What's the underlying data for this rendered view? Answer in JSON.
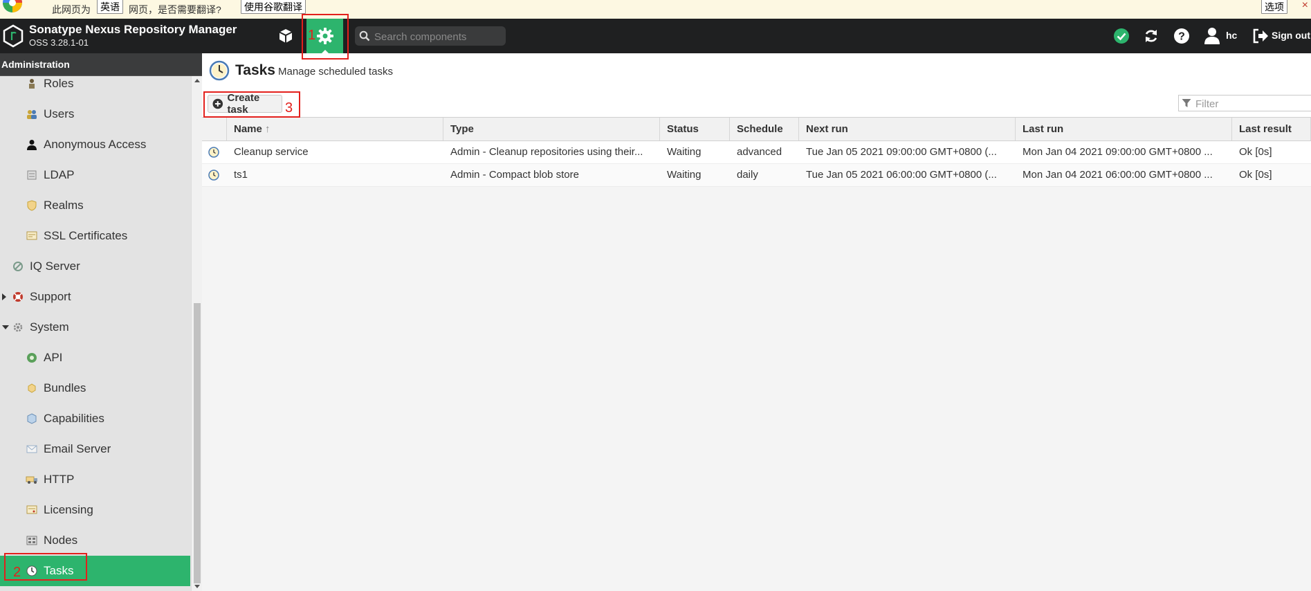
{
  "translate_bar": {
    "text_prefix": "此网页为",
    "language_button": "英语",
    "text_suffix": "网页，是否需要翻译?",
    "translate_button": "使用谷歌翻译",
    "options_button": "选项",
    "close": "×"
  },
  "header": {
    "app_title": "Sonatype Nexus Repository Manager",
    "app_version": "OSS 3.28.1-01",
    "search_placeholder": "Search components",
    "user": "hc",
    "sign_out": "Sign out",
    "accent": "#2db46d"
  },
  "sidebar": {
    "title": "Administration",
    "items": [
      {
        "label": "Roles",
        "icon": "roles-icon",
        "level": 2
      },
      {
        "label": "Users",
        "icon": "users-icon",
        "level": 2
      },
      {
        "label": "Anonymous Access",
        "icon": "anonymous-icon",
        "level": 2
      },
      {
        "label": "LDAP",
        "icon": "ldap-icon",
        "level": 2
      },
      {
        "label": "Realms",
        "icon": "realms-icon",
        "level": 2
      },
      {
        "label": "SSL Certificates",
        "icon": "ssl-icon",
        "level": 2
      },
      {
        "label": "IQ Server",
        "icon": "iq-server-icon",
        "level": 1
      },
      {
        "label": "Support",
        "icon": "support-icon",
        "level": 1,
        "expander": "collapsed"
      },
      {
        "label": "System",
        "icon": "system-icon",
        "level": 1,
        "expander": "expanded"
      },
      {
        "label": "API",
        "icon": "api-icon",
        "level": 2
      },
      {
        "label": "Bundles",
        "icon": "bundles-icon",
        "level": 2
      },
      {
        "label": "Capabilities",
        "icon": "capabilities-icon",
        "level": 2
      },
      {
        "label": "Email Server",
        "icon": "email-icon",
        "level": 2
      },
      {
        "label": "HTTP",
        "icon": "http-icon",
        "level": 2
      },
      {
        "label": "Licensing",
        "icon": "licensing-icon",
        "level": 2
      },
      {
        "label": "Nodes",
        "icon": "nodes-icon",
        "level": 2
      },
      {
        "label": "Tasks",
        "icon": "tasks-icon",
        "level": 2,
        "selected": true
      }
    ]
  },
  "main": {
    "title": "Tasks",
    "subtitle": "Manage scheduled tasks",
    "create_button": "Create task",
    "filter_placeholder": "Filter",
    "columns": [
      "Name",
      "Type",
      "Status",
      "Schedule",
      "Next run",
      "Last run",
      "Last result"
    ],
    "sort_indicator": "↑",
    "rows": [
      {
        "name": "Cleanup service",
        "type": "Admin - Cleanup repositories using their...",
        "status": "Waiting",
        "schedule": "advanced",
        "next_run": "Tue Jan 05 2021 09:00:00 GMT+0800 (...",
        "last_run": "Mon Jan 04 2021 09:00:00 GMT+0800 ...",
        "last_result": "Ok [0s]"
      },
      {
        "name": "ts1",
        "type": "Admin - Compact blob store",
        "status": "Waiting",
        "schedule": "daily",
        "next_run": "Tue Jan 05 2021 06:00:00 GMT+0800 (...",
        "last_run": "Mon Jan 04 2021 06:00:00 GMT+0800 ...",
        "last_result": "Ok [0s]"
      }
    ]
  },
  "annotations": {
    "one": "1",
    "two": "2",
    "three": "3",
    "color": "#e3201c"
  }
}
